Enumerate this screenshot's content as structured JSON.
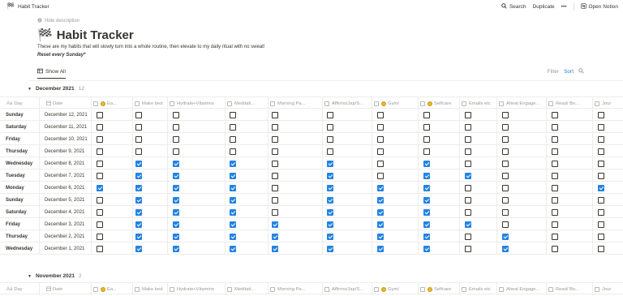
{
  "topbar": {
    "page_name": "Habit Tracker",
    "search_label": "Search",
    "duplicate_label": "Duplicate",
    "more_label": "•••",
    "open_notion_label": "Open Notion"
  },
  "header": {
    "hide_description_label": "Hide description",
    "title": "Habit Tracker",
    "description": "These are my habits that will slowly turn into a whole routine, then elevate to my daily ritual with no sweat!",
    "note": "Reset every Sunday*"
  },
  "viewbar": {
    "view_label": "Show All",
    "filter_label": "Filter",
    "sort_label": "Sort"
  },
  "columns": [
    {
      "label": "Day",
      "icon": "text-icon"
    },
    {
      "label": "Date",
      "icon": "calendar-icon"
    },
    {
      "label": "Ea...",
      "icon": "checkbox-icon"
    },
    {
      "label": "Make bed",
      "icon": "checkbox-icon"
    },
    {
      "label": "Hydrate+Vitamins",
      "icon": "checkbox-icon"
    },
    {
      "label": "Meditati...",
      "icon": "checkbox-icon"
    },
    {
      "label": "Morning Pa...",
      "icon": "checkbox-icon"
    },
    {
      "label": "Affirms/Jap/S...",
      "icon": "checkbox-icon"
    },
    {
      "label": "Gym/",
      "icon": "checkbox-icon"
    },
    {
      "label": "Selfcare",
      "icon": "checkbox-icon"
    },
    {
      "label": "Emails etc",
      "icon": "checkbox-icon"
    },
    {
      "label": "Aheal Engage...",
      "icon": "checkbox-icon"
    },
    {
      "label": "Read/ Bo...",
      "icon": "checkbox-icon"
    },
    {
      "label": "Jour",
      "icon": "checkbox-icon"
    }
  ],
  "groups": [
    {
      "name": "December 2021",
      "count": "12",
      "rows": [
        {
          "day": "Sunday",
          "date": "December 12, 2021",
          "checks": [
            false,
            false,
            false,
            false,
            false,
            false,
            false,
            false,
            false,
            false,
            false,
            false
          ]
        },
        {
          "day": "Saturday",
          "date": "December 11, 2021",
          "checks": [
            false,
            false,
            false,
            false,
            false,
            false,
            false,
            false,
            false,
            false,
            false,
            false
          ]
        },
        {
          "day": "Friday",
          "date": "December 10, 2021",
          "checks": [
            false,
            false,
            false,
            false,
            false,
            false,
            false,
            false,
            false,
            false,
            false,
            false
          ]
        },
        {
          "day": "Thursday",
          "date": "December 9, 2021",
          "checks": [
            false,
            false,
            false,
            false,
            false,
            false,
            false,
            false,
            false,
            false,
            false,
            false
          ]
        },
        {
          "day": "Wednesday",
          "date": "December 8, 2021",
          "checks": [
            false,
            true,
            true,
            true,
            false,
            true,
            false,
            true,
            false,
            false,
            false,
            false
          ]
        },
        {
          "day": "Tuesday",
          "date": "December 7, 2021",
          "checks": [
            false,
            true,
            true,
            true,
            false,
            true,
            false,
            true,
            true,
            false,
            false,
            false
          ]
        },
        {
          "day": "Monday",
          "date": "December 6, 2021",
          "checks": [
            true,
            true,
            true,
            true,
            false,
            true,
            true,
            true,
            false,
            false,
            false,
            true
          ]
        },
        {
          "day": "Sunday",
          "date": "December 5, 2021",
          "checks": [
            false,
            true,
            true,
            true,
            false,
            true,
            true,
            true,
            false,
            false,
            false,
            false
          ]
        },
        {
          "day": "Saturday",
          "date": "December 4, 2021",
          "checks": [
            false,
            true,
            true,
            true,
            false,
            true,
            true,
            true,
            false,
            false,
            false,
            false
          ]
        },
        {
          "day": "Friday",
          "date": "December 3, 2021",
          "checks": [
            false,
            true,
            true,
            true,
            true,
            true,
            true,
            true,
            true,
            false,
            false,
            false
          ]
        },
        {
          "day": "Thursday",
          "date": "December 2, 2021",
          "checks": [
            false,
            true,
            true,
            true,
            true,
            true,
            true,
            true,
            false,
            true,
            false,
            false
          ]
        },
        {
          "day": "Wednesday",
          "date": "December 1, 2021",
          "checks": [
            false,
            true,
            true,
            true,
            true,
            true,
            true,
            true,
            false,
            true,
            false,
            false
          ]
        }
      ]
    },
    {
      "name": "November 2021",
      "count": "2",
      "rows": []
    }
  ],
  "colors": {
    "accent": "#2383e2",
    "text": "#37352f",
    "muted": "#9b9a97",
    "border": "#ececeb"
  }
}
